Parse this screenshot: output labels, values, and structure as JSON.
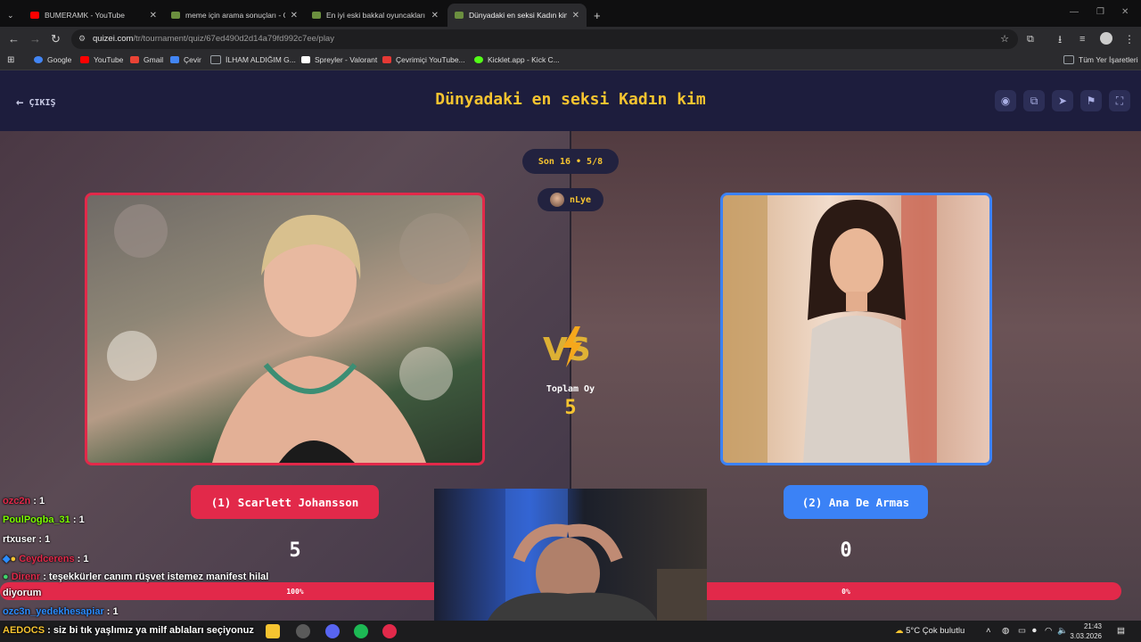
{
  "browser": {
    "tabs": [
      {
        "title": "BUMERAMK - YouTube",
        "favicon_color": "#ff0000"
      },
      {
        "title": "meme için arama sonuçları - O",
        "favicon_color": "#6b8f3f"
      },
      {
        "title": "En iyi eski bakkal oyuncakları -",
        "favicon_color": "#6b8f3f"
      },
      {
        "title": "Dünyadaki en seksi Kadın kim -",
        "favicon_color": "#6b8f3f"
      }
    ],
    "new_tab": "+",
    "url_host": "quizei.com",
    "url_path": "/tr/tournament/quiz/67ed490d2d14a79fd992c7ee/play",
    "bookmarks": [
      {
        "label": "Google",
        "color": "#4285f4"
      },
      {
        "label": "YouTube",
        "color": "#ff0000"
      },
      {
        "label": "Gmail",
        "color": "#ea4335"
      },
      {
        "label": "Çevir",
        "color": "#4285f4"
      },
      {
        "label": "İLHAM ALDIĞIM G...",
        "color": "#9aa0a6"
      },
      {
        "label": "Spreyler - Valorant",
        "color": "#ffffff"
      },
      {
        "label": "Çevrimiçi YouTube...",
        "color": "#e53935"
      },
      {
        "label": "Kicklet.app - Kick C...",
        "color": "#53fc18"
      }
    ],
    "bookmarks_all": "Tüm Yer İşaretleri"
  },
  "quiz": {
    "exit_label": "ÇIKIŞ",
    "title": "Dünyadaki en seksi Kadın kim",
    "round": "Son 16 • 5/8",
    "user": "nLye",
    "total_votes_label": "Toplam Oy",
    "total_votes": "5",
    "left": {
      "name": "(1) Scarlett Johansson",
      "score": "5",
      "percent": "100%",
      "color": "#e2294a"
    },
    "right": {
      "name": "(2) Ana De Armas",
      "score": "0",
      "percent": "0%",
      "color": "#3b82f6"
    },
    "header_icons": [
      "eye-icon",
      "share-icon",
      "send-icon",
      "flag-icon",
      "fullscreen-icon"
    ]
  },
  "chat": [
    {
      "user": "ozc2n",
      "msg": ": 1",
      "color": "#e2294a"
    },
    {
      "user": "PoulPogba_31",
      "msg": ": 1",
      "color": "#7cfc00"
    },
    {
      "user": "rtxuser",
      "msg": ": 1",
      "color": "#ffffff"
    },
    {
      "user": "Ceydcerens",
      "msg": ": 1",
      "color": "#e2294a"
    },
    {
      "user": "Direnr",
      "msg": ": teşekkürler canım rüşvet istemez manifest hilal",
      "color": "#e2294a"
    },
    {
      "user": "",
      "msg": "diyorum",
      "color": "#ffffff"
    },
    {
      "user": "ozc3n_yedekhesapiar",
      "msg": ": 1",
      "color": "#2b8cff"
    },
    {
      "user": "AEDOCS",
      "msg": ": siz bi tık yaşlımız ya milf ablaları seçiyonuz",
      "color": "#f6c430"
    }
  ],
  "taskbar": {
    "weather": "5°C  Çok bulutlu",
    "time": "21:43",
    "date": "3.03.2026"
  }
}
